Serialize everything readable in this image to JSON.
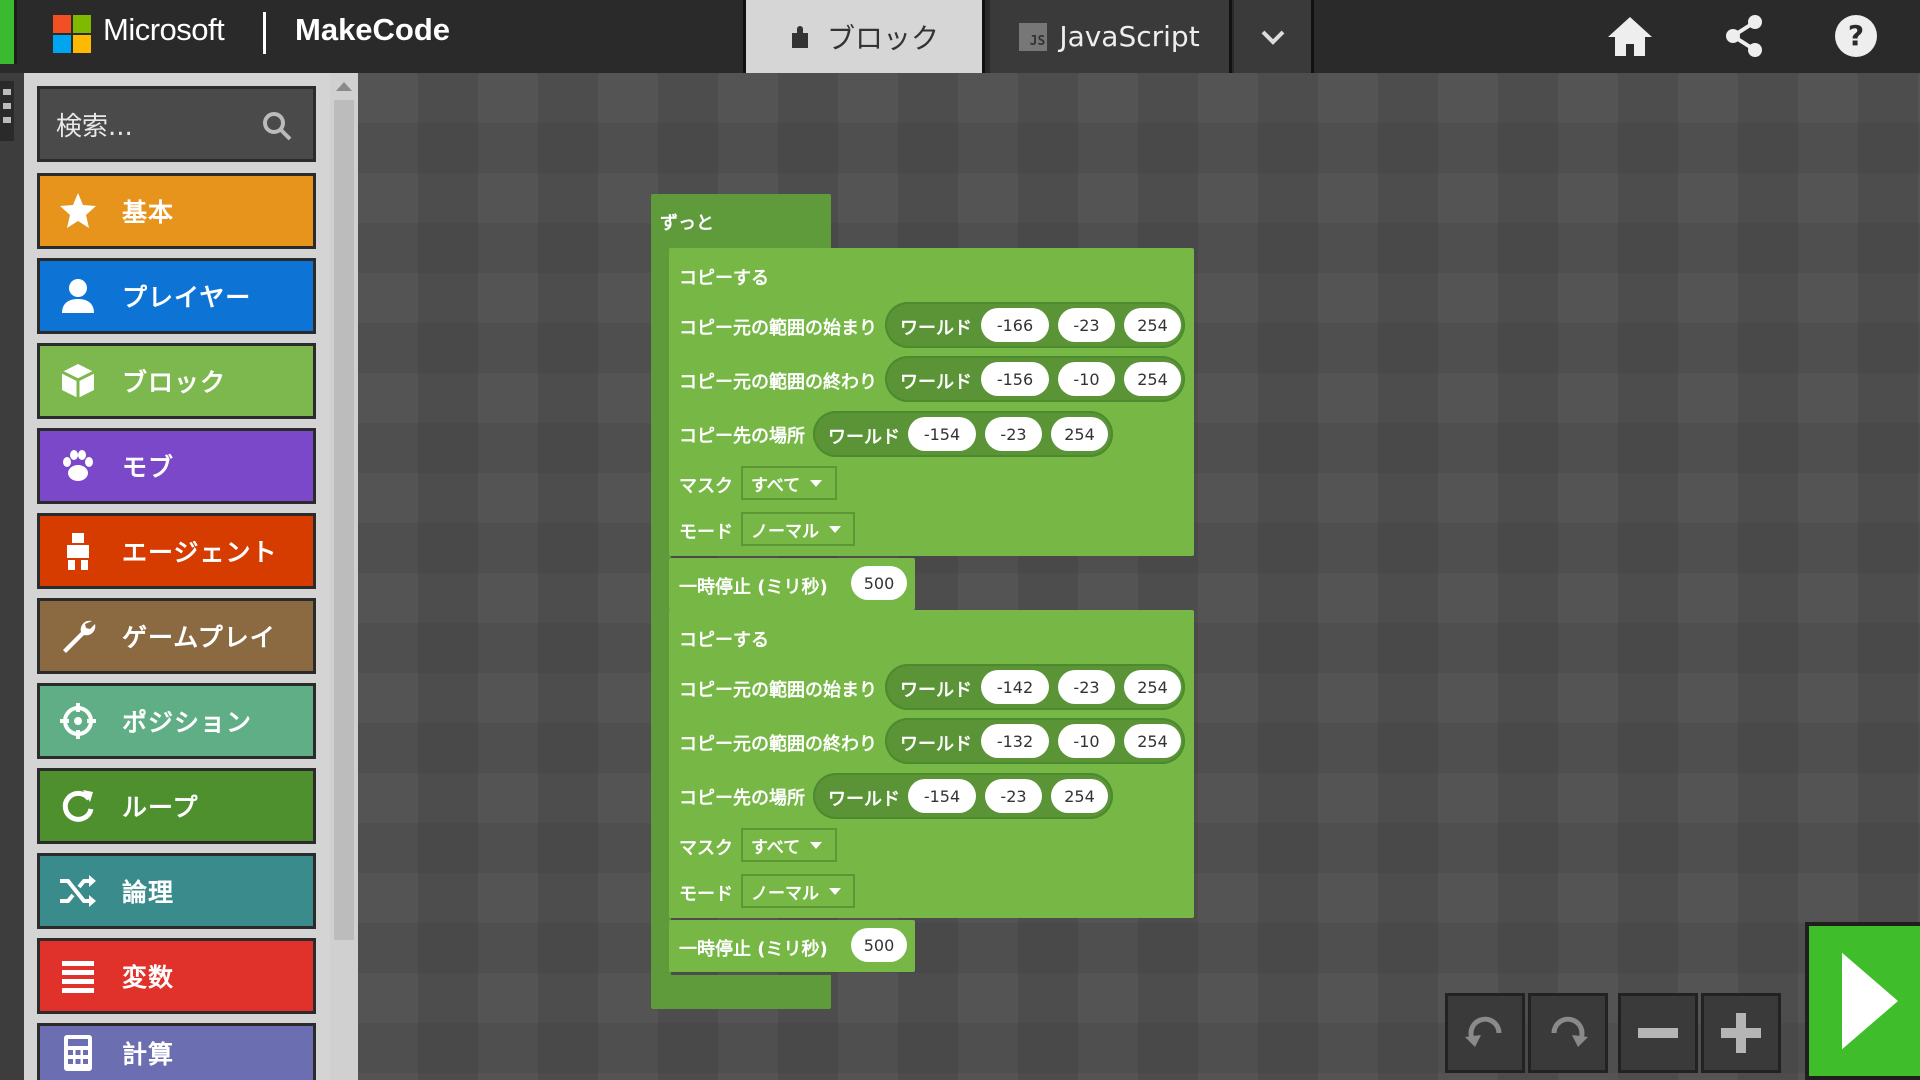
{
  "header": {
    "brand": "Microsoft",
    "product": "MakeCode",
    "tabs": [
      {
        "label": "ブロック",
        "active": true
      },
      {
        "label": "JavaScript",
        "active": false
      }
    ]
  },
  "search": {
    "placeholder": "検索..."
  },
  "categories": [
    {
      "label": "基本",
      "color": "#e6941c",
      "icon": "star-icon"
    },
    {
      "label": "プレイヤー",
      "color": "#0d74d6",
      "icon": "person-icon"
    },
    {
      "label": "ブロック",
      "color": "#7cb84e",
      "icon": "cube-icon"
    },
    {
      "label": "モブ",
      "color": "#7b48c9",
      "icon": "paw-icon"
    },
    {
      "label": "エージェント",
      "color": "#d63b00",
      "icon": "agent-icon"
    },
    {
      "label": "ゲームプレイ",
      "color": "#8b6a42",
      "icon": "wrench-icon"
    },
    {
      "label": "ポジション",
      "color": "#5fae86",
      "icon": "crosshair-icon"
    },
    {
      "label": "ループ",
      "color": "#4e8f2e",
      "icon": "loop-icon"
    },
    {
      "label": "論理",
      "color": "#3a8c8c",
      "icon": "shuffle-icon"
    },
    {
      "label": "変数",
      "color": "#e0322a",
      "icon": "list-icon"
    },
    {
      "label": "計算",
      "color": "#6b6eb0",
      "icon": "calculator-icon"
    }
  ],
  "workspace": {
    "forever_label": "ずっと",
    "groups": [
      {
        "clone_label": "コピーする",
        "rows": [
          {
            "label": "コピー元の範囲の始まり",
            "world": "ワールド",
            "values": [
              "-166",
              "-23",
              "254"
            ]
          },
          {
            "label": "コピー元の範囲の終わり",
            "world": "ワールド",
            "values": [
              "-156",
              "-10",
              "254"
            ]
          },
          {
            "label": "コピー先の場所",
            "world": "ワールド",
            "values": [
              "-154",
              "-23",
              "254"
            ]
          }
        ],
        "mask_label": "マスク",
        "mask_value": "すべて",
        "mode_label": "モード",
        "mode_value": "ノーマル",
        "pause_label": "一時停止 (ミリ秒)",
        "pause_value": "500"
      },
      {
        "clone_label": "コピーする",
        "rows": [
          {
            "label": "コピー元の範囲の始まり",
            "world": "ワールド",
            "values": [
              "-142",
              "-23",
              "254"
            ]
          },
          {
            "label": "コピー元の範囲の終わり",
            "world": "ワールド",
            "values": [
              "-132",
              "-10",
              "254"
            ]
          },
          {
            "label": "コピー先の場所",
            "world": "ワールド",
            "values": [
              "-154",
              "-23",
              "254"
            ]
          }
        ],
        "mask_label": "マスク",
        "mask_value": "すべて",
        "mode_label": "モード",
        "mode_value": "ノーマル",
        "pause_label": "一時停止 (ミリ秒)",
        "pause_value": "500"
      }
    ]
  },
  "colors": {
    "block_dark": "#5f9a3b",
    "block_light": "#77b745",
    "run": "#3fbd2b"
  }
}
